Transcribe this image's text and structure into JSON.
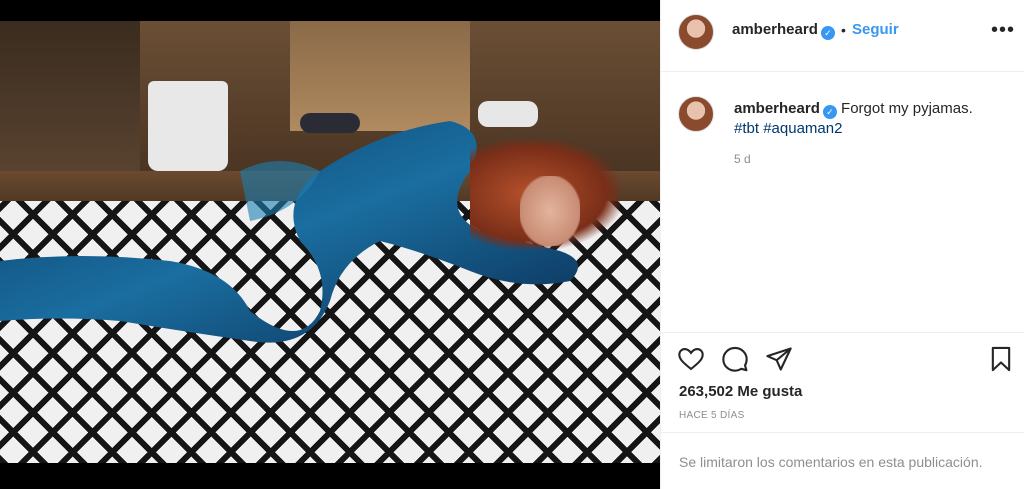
{
  "post": {
    "username": "amberheard",
    "follow_label": "Seguir",
    "bullet": "•",
    "more_label": "•••",
    "verified_mark": "✓"
  },
  "caption": {
    "username": "amberheard",
    "text": "Forgot my pyjamas.",
    "hashtags": [
      "#tbt",
      "#aquaman2"
    ],
    "age": "5 d"
  },
  "engagement": {
    "likes": "263,502 Me gusta",
    "posted": "HACE 5 DÍAS",
    "comments_disabled": "Se limitaron los comentarios en esta publicación."
  },
  "icons": {
    "like": "heart-icon",
    "comment": "comment-icon",
    "share": "paper-plane-icon",
    "save": "bookmark-icon",
    "verified": "verified-badge-icon",
    "more": "more-options-icon"
  },
  "colors": {
    "link": "#3897f0",
    "hashtag": "#00376b",
    "muted": "#8e8e8e",
    "text": "#262626"
  }
}
